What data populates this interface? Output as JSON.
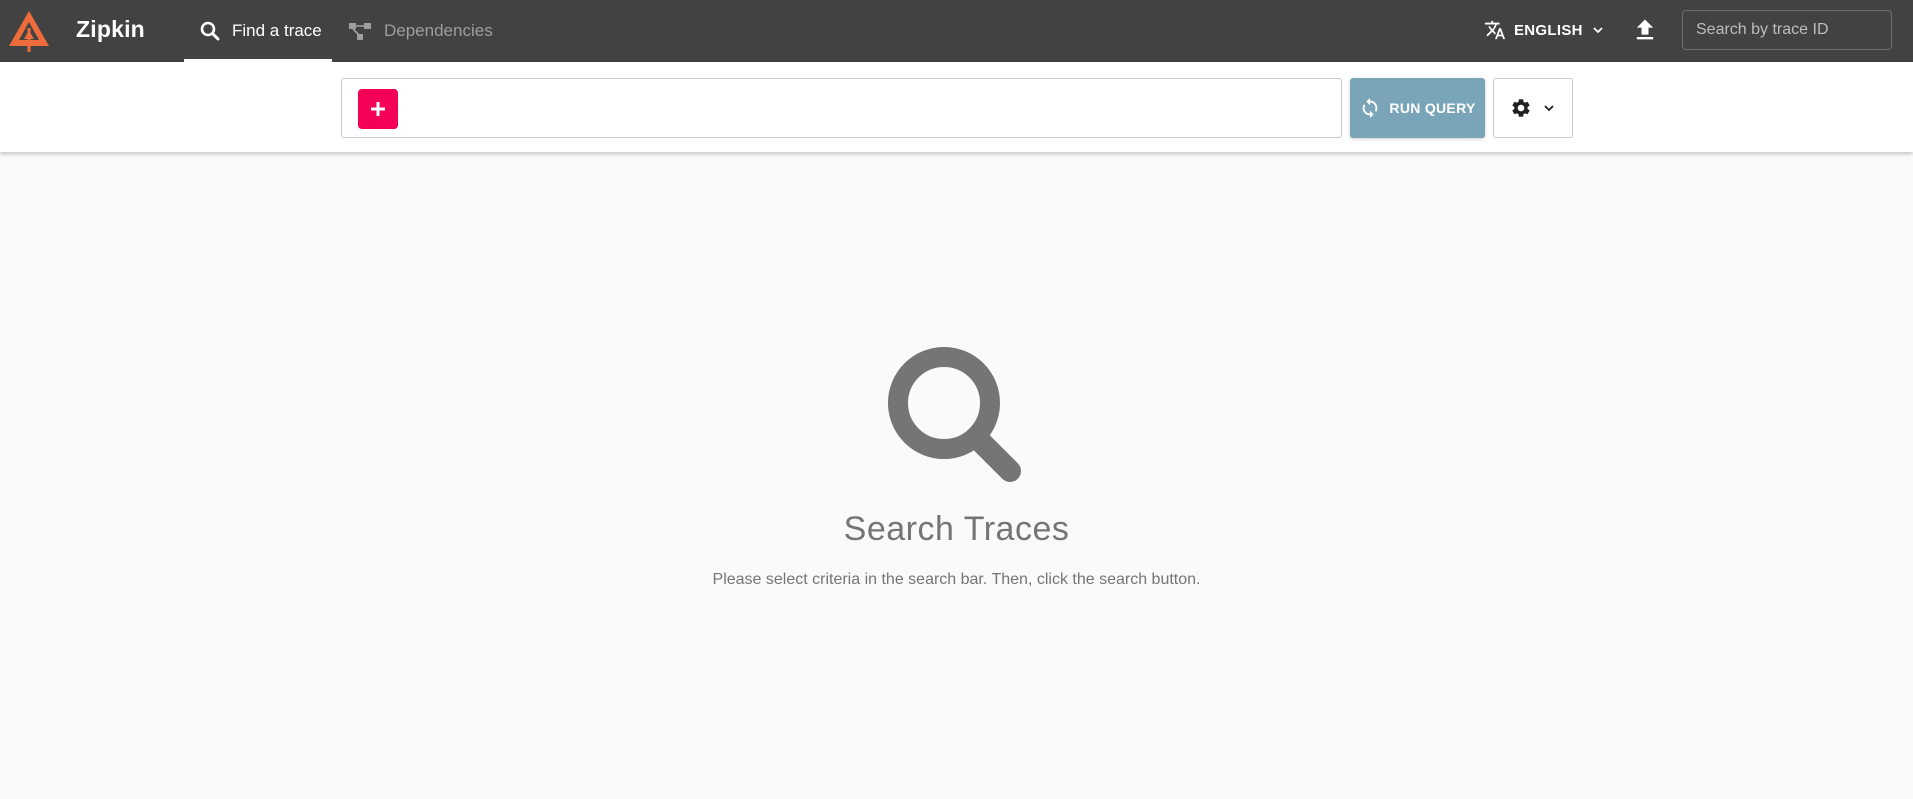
{
  "header": {
    "brand": "Zipkin",
    "tabs": [
      {
        "label": "Find a trace",
        "active": true,
        "icon": "search-icon"
      },
      {
        "label": "Dependencies",
        "active": false,
        "icon": "dependencies-icon"
      }
    ],
    "language": "ENGLISH",
    "trace_search_placeholder": "Search by trace ID"
  },
  "querybar": {
    "run_label": "RUN QUERY"
  },
  "empty_state": {
    "title": "Search Traces",
    "message": "Please select criteria in the search bar. Then, click the search button."
  },
  "colors": {
    "appbar": "#424242",
    "logo": "#ee6c3b",
    "add_button": "#f50057",
    "run_button": "#7aa5b8",
    "empty_text": "#757575"
  }
}
